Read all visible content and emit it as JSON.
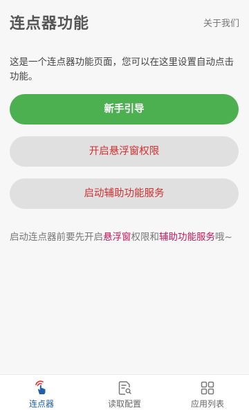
{
  "header": {
    "title": "连点器功能",
    "about_label": "关于我们"
  },
  "intro_text": "这是一个连点器功能页面，您可以在这里设置自动点击功能。",
  "buttons": {
    "tutorial_label": "新手引导",
    "overlay_permission_label": "开启悬浮窗权限",
    "accessibility_service_label": "启动辅助功能服务"
  },
  "note": {
    "part1": "启动连点器前要先开启",
    "highlight1": "悬浮窗",
    "part2": "权限和",
    "highlight2": "辅助功能服务",
    "part3": "哦~"
  },
  "colors": {
    "primary_button": "#4caf50",
    "secondary_button_text": "#d32f2f",
    "highlight_text": "#c2185b",
    "active_tab": "#1e5fa8"
  },
  "bottom_nav": {
    "items": [
      {
        "label": "连点器",
        "icon": "tap-finger-icon",
        "active": true
      },
      {
        "label": "读取配置",
        "icon": "search-document-icon",
        "active": false
      },
      {
        "label": "应用列表",
        "icon": "app-grid-icon",
        "active": false
      }
    ]
  }
}
